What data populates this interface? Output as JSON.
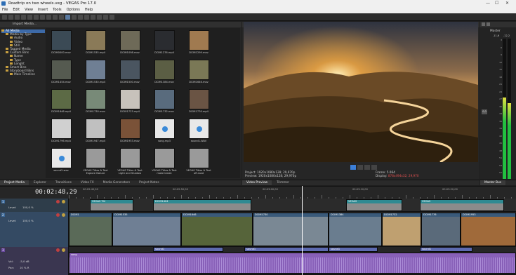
{
  "window": {
    "title": "Roadtrip on two wheels.veg - VEGAS Pro 17.0",
    "minimize": "—",
    "maximize": "☐",
    "close": "✕"
  },
  "menu": [
    "File",
    "Edit",
    "View",
    "Insert",
    "Tools",
    "Options",
    "Help"
  ],
  "media": {
    "import_label": "Import Media...",
    "tree": [
      {
        "label": "All Media",
        "selected": true
      },
      {
        "label": "Media by Type"
      },
      {
        "label": "Audio"
      },
      {
        "label": "Video"
      },
      {
        "label": "Still"
      },
      {
        "label": "Tagged Media"
      },
      {
        "label": "Custom Bins"
      },
      {
        "label": "Name"
      },
      {
        "label": "Type"
      },
      {
        "label": "Lenght"
      },
      {
        "label": "Smart Bins"
      },
      {
        "label": "Storyboard Bins"
      },
      {
        "label": "Main Timeline"
      }
    ],
    "items": [
      {
        "label": "DCIM0000.mov",
        "color": "#3b4a55"
      },
      {
        "label": "DCIM1535.mp4",
        "color": "#8a7a58"
      },
      {
        "label": "DCIM1098.mov",
        "color": "#6e6a58"
      },
      {
        "label": "DCIM1276.mp4",
        "color": "#2a2c30"
      },
      {
        "label": "DCIM1299.mov",
        "color": "#a07a50"
      },
      {
        "label": "DCIM1454.mov",
        "color": "#555a50"
      },
      {
        "label": "DCIM1530.mp4",
        "color": "#6f7f94"
      },
      {
        "label": "DCIM1500.mov",
        "color": "#4a5560"
      },
      {
        "label": "DCIM1384.mov",
        "color": "#5b5e44"
      },
      {
        "label": "DCIM1646.mov",
        "color": "#7a7856"
      },
      {
        "label": "DCIM1646.mp4",
        "color": "#5c6a45"
      },
      {
        "label": "DCIM1730.mov",
        "color": "#788a78"
      },
      {
        "label": "DCIM1723.mp4",
        "color": "#c7c2bb"
      },
      {
        "label": "DCIM1732.mov",
        "color": "#596b7d"
      },
      {
        "label": "DCIM1776.mp4",
        "color": "#6a5444"
      },
      {
        "label": "DCIM1796.mp4",
        "color": "#d0d0d0"
      },
      {
        "label": "DCIM1947.mp4",
        "color": "#c0c0c0"
      },
      {
        "label": "DCIM1953.mov",
        "color": "#7a5238"
      },
      {
        "label": "song.mp3",
        "color": "#e8e8e8",
        "audio": true
      },
      {
        "label": "sound1.WAV",
        "color": "#e8e8e8",
        "audio": true
      },
      {
        "label": "sound2.wav",
        "color": "#e8e8e8",
        "audio": true
      },
      {
        "label": "VEGAS Titles & Text Explore Nature",
        "color": "#9a9a9a"
      },
      {
        "label": "VEGAS Titles & Text Light and Shadow",
        "color": "#9a9a9a"
      },
      {
        "label": "VEGAS Titles & Text make break",
        "color": "#9a9a9a"
      },
      {
        "label": "VEGAS Titles & Text off-road",
        "color": "#9a9a9a"
      }
    ],
    "tabs": [
      "Project Media",
      "Explorer",
      "Transitions",
      "Video FX",
      "Media Generators",
      "Project Notes"
    ]
  },
  "preview": {
    "quality": "Best (Full)",
    "project": "Project:  1920x1080x128; 29,970p",
    "preview_res": "Preview:  1920x1080x128; 29,970p",
    "frame_label": "Frame:",
    "frame_value": "5.064",
    "display_label": "Display:",
    "display_value": "878x494x32; 29,970",
    "tabs": [
      "Video Preview",
      "Trimmer"
    ]
  },
  "master": {
    "title": "Master",
    "peak_left": "-11,6",
    "peak_right": "-12,2",
    "scale": [
      "3",
      "6",
      "9",
      "12",
      "15",
      "18",
      "21",
      "24",
      "27",
      "30",
      "33",
      "36",
      "39",
      "42",
      "45",
      "48",
      "51",
      "54",
      "57"
    ],
    "bus_label": "Master Bus",
    "level_left": 0.58,
    "level_right": 0.54,
    "fader_a": "0,0",
    "fader_b": "0,0"
  },
  "timeline": {
    "timecode": "00:02:48,29",
    "ruler": [
      "00:02:40,00",
      "00:02:50,00",
      "00:03:00,00",
      "00:03:10,00",
      "00:03:20,00"
    ],
    "tracks": [
      {
        "number": "1",
        "level_label": "Level:",
        "level_value": "100,0 %"
      },
      {
        "number": "2",
        "level_label": "Level:",
        "level_value": "100,0 %"
      },
      {
        "number": "3",
        "vol_label": "Vol:",
        "vol_value": "-5,0 dB",
        "pan_label": "Pan:",
        "pan_value": "10 % R"
      }
    ],
    "track1_clips": [
      {
        "label": "VEGAS Titl",
        "color": "#2f8a92"
      },
      {
        "label": "DCIM1404",
        "color": "#2f8a92"
      },
      {
        "label": "VEGAS",
        "color": "#2f8a92"
      },
      {
        "label": "VEGAS",
        "color": "#2f8a92"
      }
    ],
    "track2_clips": [
      {
        "label": "DCIM1",
        "color": "#3a5a7a"
      },
      {
        "label": "DCIM1535",
        "color": "#3a5a7a"
      },
      {
        "label": "DCIM1646",
        "color": "#3a5a7a"
      },
      {
        "label": "DCIM1730",
        "color": "#3a5a7a"
      },
      {
        "label": "DCIM1384",
        "color": "#3a5a7a"
      },
      {
        "label": "DCIM1732",
        "color": "#3a5a7a"
      },
      {
        "label": "DCIM1776",
        "color": "#3a5a7a"
      },
      {
        "label": "DCIM1953",
        "color": "#3a5a7a"
      }
    ],
    "sound_clips": [
      {
        "label": "sound1",
        "color": "#5d6ab0"
      },
      {
        "label": "sound1",
        "color": "#5d6ab0"
      },
      {
        "label": "sound1",
        "color": "#5d6ab0"
      },
      {
        "label": "sound1",
        "color": "#5d6ab0"
      }
    ],
    "song_label": "song",
    "song_color": "#8860b8"
  }
}
